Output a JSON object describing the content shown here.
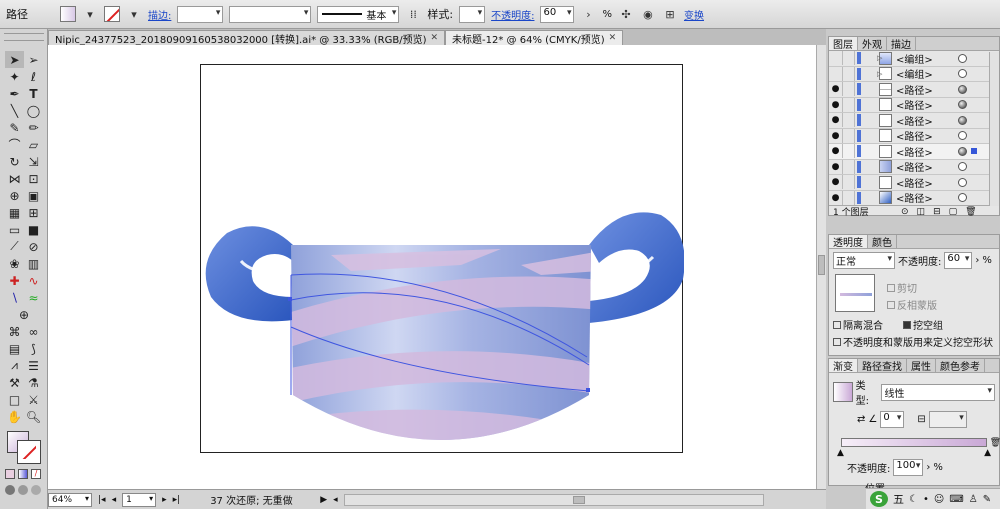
{
  "control_bar": {
    "object_type": "路径",
    "stroke_label": "描边:",
    "stroke_weight": "",
    "stroke_profile": "基本",
    "style_label": "样式:",
    "opacity_label": "不透明度:",
    "opacity_value": "60",
    "opacity_unit": "%",
    "transform_label": "变换"
  },
  "documents": [
    {
      "title": "Nipic_24377523_20180909160538032000  [转换].ai* @ 33.33% (RGB/预览)",
      "active": false
    },
    {
      "title": "未标题-12* @ 64% (CMYK/预览)",
      "active": true
    }
  ],
  "status_bar": {
    "zoom": "64%",
    "page": "1",
    "message": "37 次还原; 无重做"
  },
  "layers_panel": {
    "tabs": [
      "图层",
      "外观",
      "描边"
    ],
    "rows": [
      {
        "name": "<编组>",
        "visible": false,
        "expandable": true,
        "thumb": "group"
      },
      {
        "name": "<编组>",
        "visible": false,
        "expandable": true,
        "thumb": "blank"
      },
      {
        "name": "<路径>",
        "visible": true,
        "expandable": false,
        "thumb": "line"
      },
      {
        "name": "<路径>",
        "visible": true,
        "expandable": false,
        "thumb": "blank"
      },
      {
        "name": "<路径>",
        "visible": true,
        "expandable": false,
        "thumb": "blank"
      },
      {
        "name": "<路径>",
        "visible": true,
        "expandable": false,
        "thumb": "blank"
      },
      {
        "name": "<路径>",
        "visible": true,
        "expandable": false,
        "thumb": "blank",
        "selected": true
      },
      {
        "name": "<路径>",
        "visible": true,
        "expandable": false,
        "thumb": "gradient"
      },
      {
        "name": "<路径>",
        "visible": true,
        "expandable": false,
        "thumb": "blank"
      },
      {
        "name": "<路径>",
        "visible": true,
        "expandable": false,
        "thumb": "blue"
      }
    ],
    "footer": "1 个图层"
  },
  "transparency_panel": {
    "tabs": [
      "透明度",
      "颜色"
    ],
    "blend_mode": "正常",
    "opacity_label": "不透明度:",
    "opacity_value": "60",
    "opacity_unit": "%",
    "clip_label": "剪切",
    "invert_mask_label": "反相蒙版",
    "isolate_blending_label": "隔离混合",
    "knockout_group_label": "挖空组",
    "opacity_mask_knockout_label": "不透明度和蒙版用来定义挖空形状"
  },
  "gradient_panel": {
    "tabs": [
      "渐变",
      "路径查找",
      "属性",
      "颜色参考"
    ],
    "type_label": "类型:",
    "type_value": "线性",
    "angle_value": "0",
    "opacity_label": "不透明度:",
    "opacity_value": "100",
    "opacity_unit": "%",
    "location_label": "位置"
  },
  "taskbar": {
    "ime_label": "五"
  },
  "colors": {
    "pot_blue": "#7e92d2",
    "stripe_pink": "#cdb7dc",
    "handle_blue": "#2f5fc2",
    "selection_blue": "#3f56e0"
  }
}
